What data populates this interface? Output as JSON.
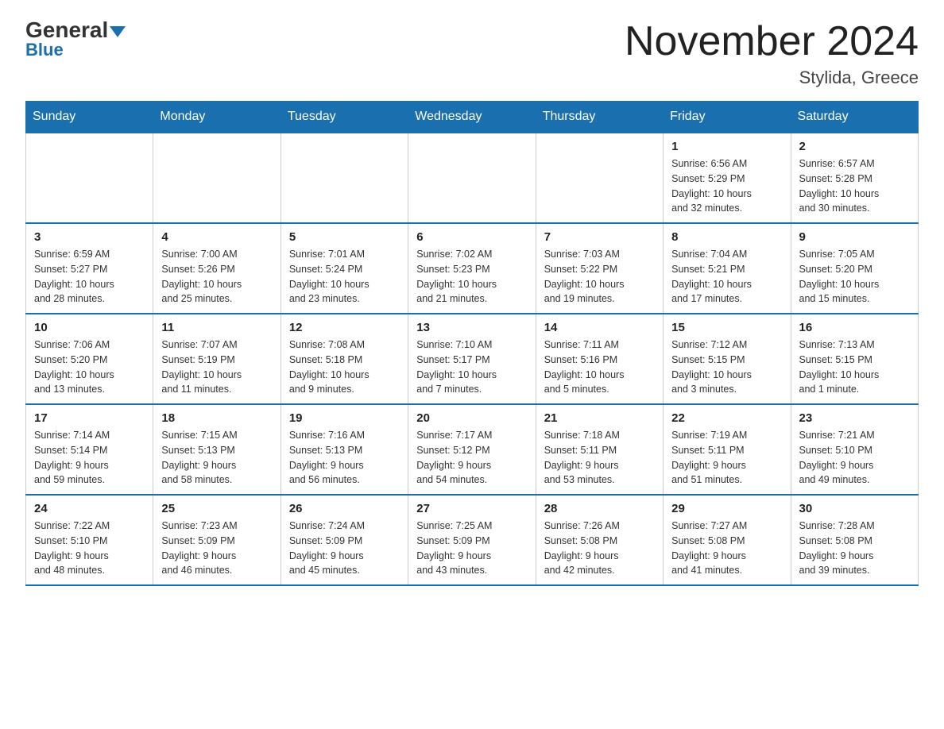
{
  "header": {
    "logo_general": "General",
    "logo_blue": "Blue",
    "month_title": "November 2024",
    "location": "Stylida, Greece"
  },
  "weekdays": [
    "Sunday",
    "Monday",
    "Tuesday",
    "Wednesday",
    "Thursday",
    "Friday",
    "Saturday"
  ],
  "weeks": [
    [
      {
        "day": "",
        "info": ""
      },
      {
        "day": "",
        "info": ""
      },
      {
        "day": "",
        "info": ""
      },
      {
        "day": "",
        "info": ""
      },
      {
        "day": "",
        "info": ""
      },
      {
        "day": "1",
        "info": "Sunrise: 6:56 AM\nSunset: 5:29 PM\nDaylight: 10 hours\nand 32 minutes."
      },
      {
        "day": "2",
        "info": "Sunrise: 6:57 AM\nSunset: 5:28 PM\nDaylight: 10 hours\nand 30 minutes."
      }
    ],
    [
      {
        "day": "3",
        "info": "Sunrise: 6:59 AM\nSunset: 5:27 PM\nDaylight: 10 hours\nand 28 minutes."
      },
      {
        "day": "4",
        "info": "Sunrise: 7:00 AM\nSunset: 5:26 PM\nDaylight: 10 hours\nand 25 minutes."
      },
      {
        "day": "5",
        "info": "Sunrise: 7:01 AM\nSunset: 5:24 PM\nDaylight: 10 hours\nand 23 minutes."
      },
      {
        "day": "6",
        "info": "Sunrise: 7:02 AM\nSunset: 5:23 PM\nDaylight: 10 hours\nand 21 minutes."
      },
      {
        "day": "7",
        "info": "Sunrise: 7:03 AM\nSunset: 5:22 PM\nDaylight: 10 hours\nand 19 minutes."
      },
      {
        "day": "8",
        "info": "Sunrise: 7:04 AM\nSunset: 5:21 PM\nDaylight: 10 hours\nand 17 minutes."
      },
      {
        "day": "9",
        "info": "Sunrise: 7:05 AM\nSunset: 5:20 PM\nDaylight: 10 hours\nand 15 minutes."
      }
    ],
    [
      {
        "day": "10",
        "info": "Sunrise: 7:06 AM\nSunset: 5:20 PM\nDaylight: 10 hours\nand 13 minutes."
      },
      {
        "day": "11",
        "info": "Sunrise: 7:07 AM\nSunset: 5:19 PM\nDaylight: 10 hours\nand 11 minutes."
      },
      {
        "day": "12",
        "info": "Sunrise: 7:08 AM\nSunset: 5:18 PM\nDaylight: 10 hours\nand 9 minutes."
      },
      {
        "day": "13",
        "info": "Sunrise: 7:10 AM\nSunset: 5:17 PM\nDaylight: 10 hours\nand 7 minutes."
      },
      {
        "day": "14",
        "info": "Sunrise: 7:11 AM\nSunset: 5:16 PM\nDaylight: 10 hours\nand 5 minutes."
      },
      {
        "day": "15",
        "info": "Sunrise: 7:12 AM\nSunset: 5:15 PM\nDaylight: 10 hours\nand 3 minutes."
      },
      {
        "day": "16",
        "info": "Sunrise: 7:13 AM\nSunset: 5:15 PM\nDaylight: 10 hours\nand 1 minute."
      }
    ],
    [
      {
        "day": "17",
        "info": "Sunrise: 7:14 AM\nSunset: 5:14 PM\nDaylight: 9 hours\nand 59 minutes."
      },
      {
        "day": "18",
        "info": "Sunrise: 7:15 AM\nSunset: 5:13 PM\nDaylight: 9 hours\nand 58 minutes."
      },
      {
        "day": "19",
        "info": "Sunrise: 7:16 AM\nSunset: 5:13 PM\nDaylight: 9 hours\nand 56 minutes."
      },
      {
        "day": "20",
        "info": "Sunrise: 7:17 AM\nSunset: 5:12 PM\nDaylight: 9 hours\nand 54 minutes."
      },
      {
        "day": "21",
        "info": "Sunrise: 7:18 AM\nSunset: 5:11 PM\nDaylight: 9 hours\nand 53 minutes."
      },
      {
        "day": "22",
        "info": "Sunrise: 7:19 AM\nSunset: 5:11 PM\nDaylight: 9 hours\nand 51 minutes."
      },
      {
        "day": "23",
        "info": "Sunrise: 7:21 AM\nSunset: 5:10 PM\nDaylight: 9 hours\nand 49 minutes."
      }
    ],
    [
      {
        "day": "24",
        "info": "Sunrise: 7:22 AM\nSunset: 5:10 PM\nDaylight: 9 hours\nand 48 minutes."
      },
      {
        "day": "25",
        "info": "Sunrise: 7:23 AM\nSunset: 5:09 PM\nDaylight: 9 hours\nand 46 minutes."
      },
      {
        "day": "26",
        "info": "Sunrise: 7:24 AM\nSunset: 5:09 PM\nDaylight: 9 hours\nand 45 minutes."
      },
      {
        "day": "27",
        "info": "Sunrise: 7:25 AM\nSunset: 5:09 PM\nDaylight: 9 hours\nand 43 minutes."
      },
      {
        "day": "28",
        "info": "Sunrise: 7:26 AM\nSunset: 5:08 PM\nDaylight: 9 hours\nand 42 minutes."
      },
      {
        "day": "29",
        "info": "Sunrise: 7:27 AM\nSunset: 5:08 PM\nDaylight: 9 hours\nand 41 minutes."
      },
      {
        "day": "30",
        "info": "Sunrise: 7:28 AM\nSunset: 5:08 PM\nDaylight: 9 hours\nand 39 minutes."
      }
    ]
  ]
}
